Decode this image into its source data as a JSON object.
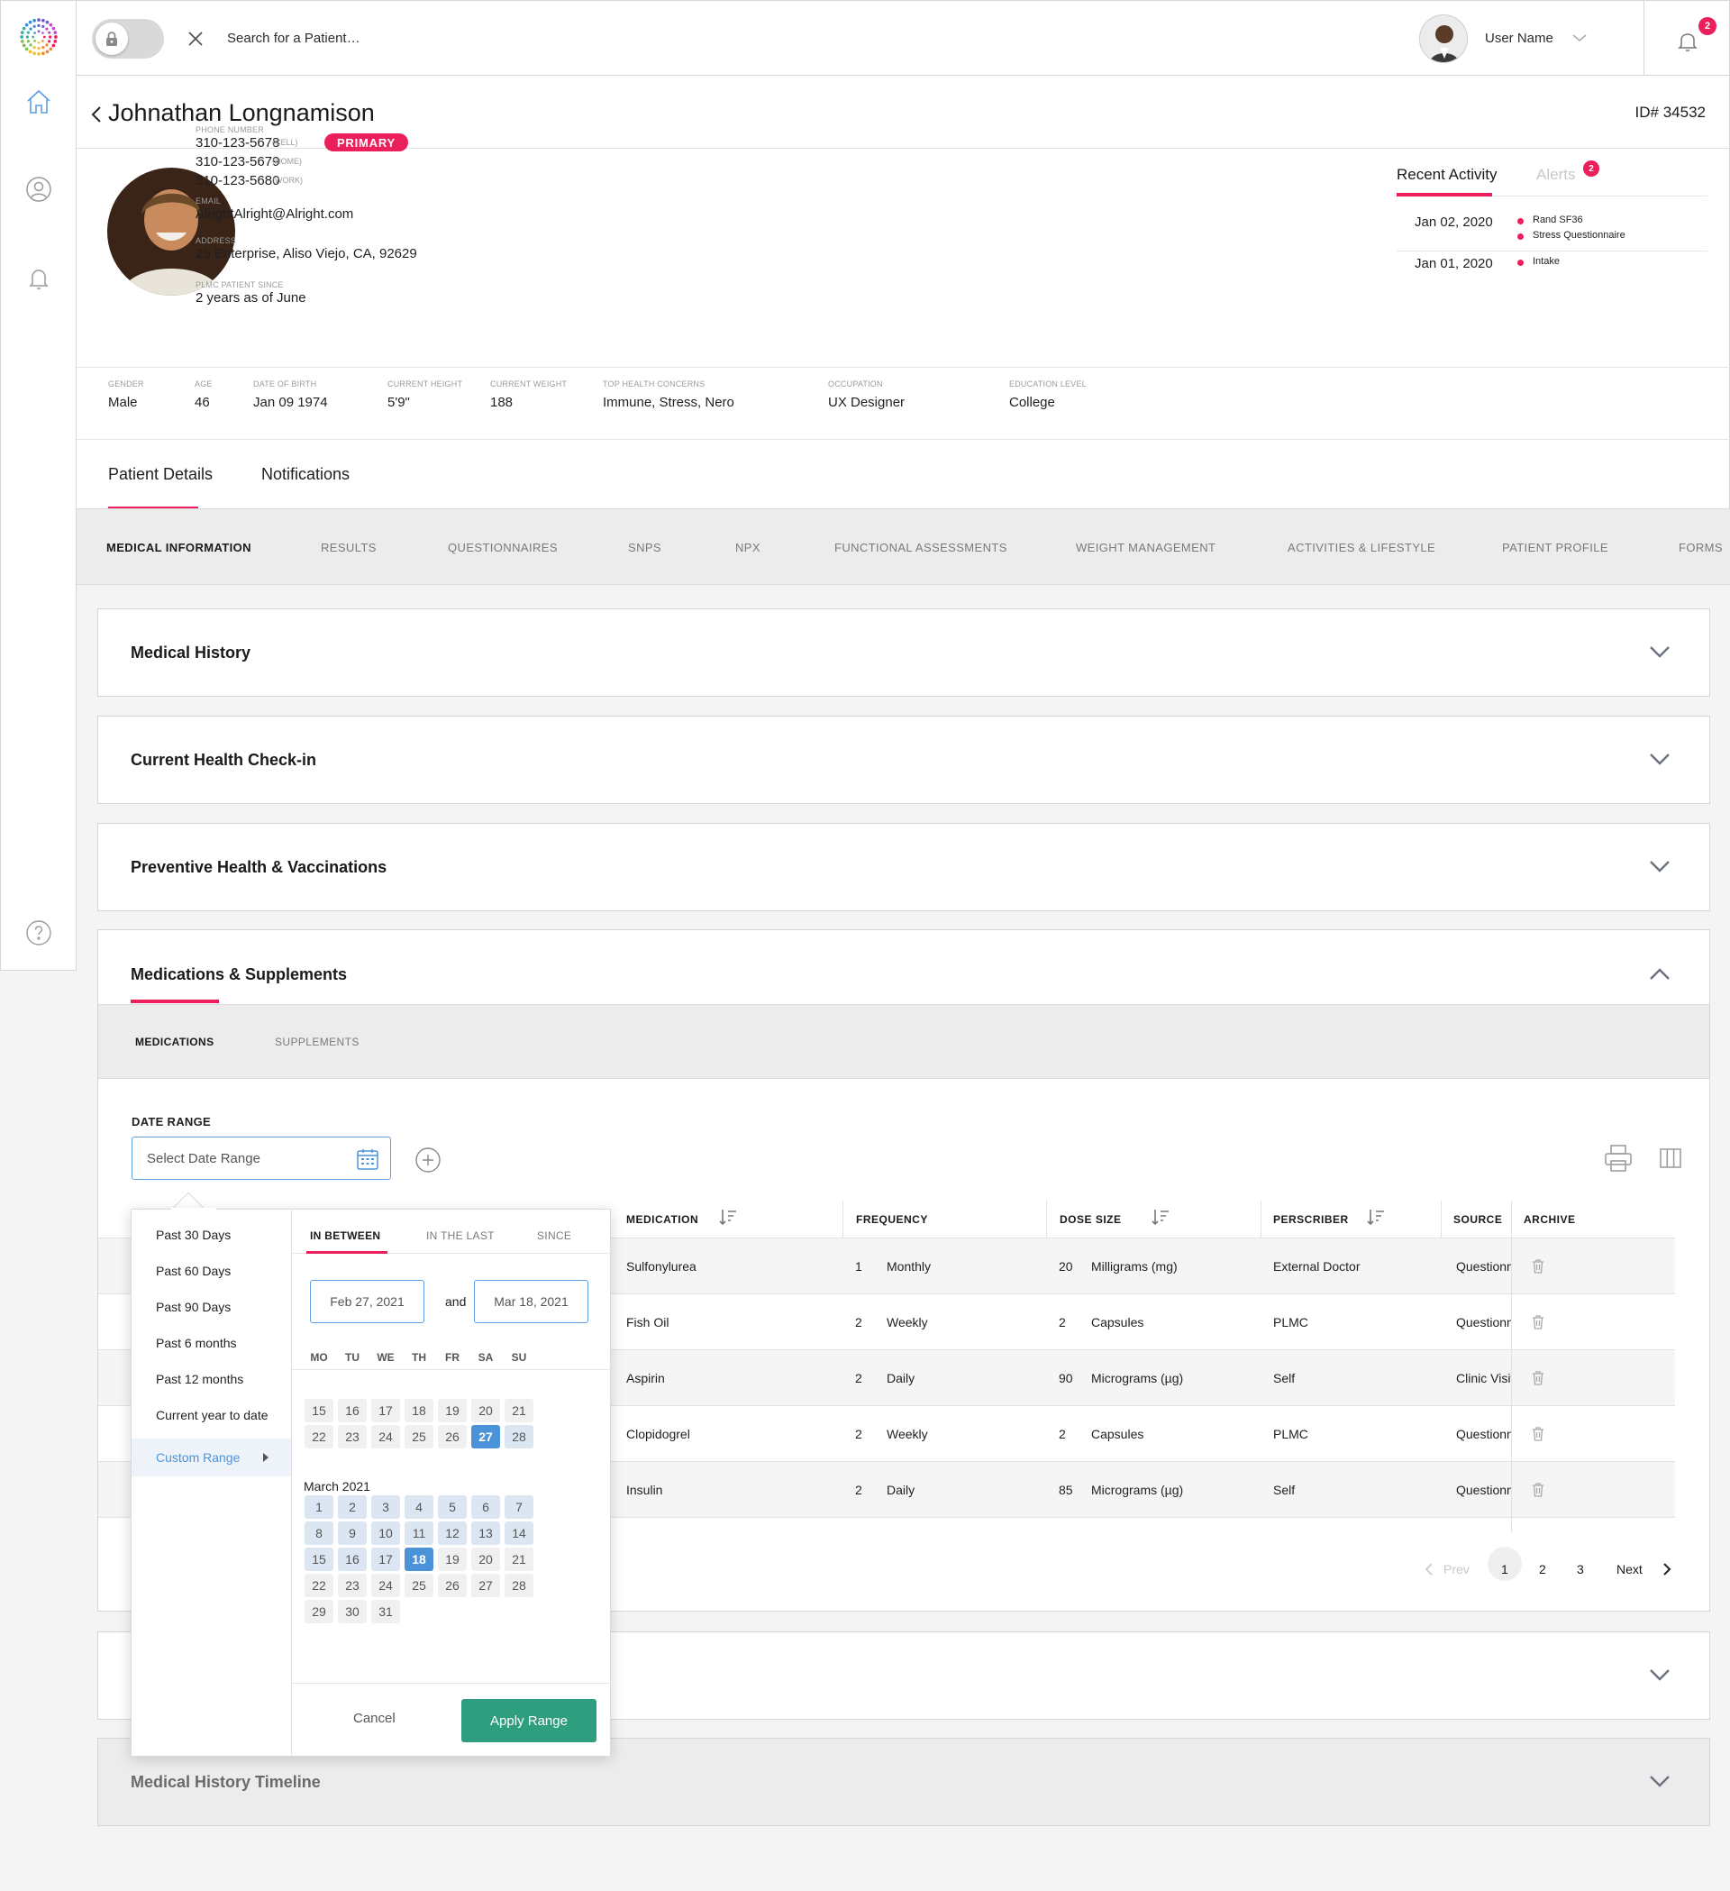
{
  "topbar": {
    "search_placeholder": "Search for a Patient…",
    "user_name": "User Name",
    "notification_count": "2"
  },
  "patient": {
    "name": "Johnathan Longnamison",
    "id": "ID# 34532",
    "phone_label": "PHONE NUMBER",
    "phones": [
      {
        "number": "310-123-5678",
        "type": "(CELL)"
      },
      {
        "number": "310-123-5679",
        "type": "(HOME)"
      },
      {
        "number": "310-123-5680",
        "type": "(WORK)"
      }
    ],
    "primary_label": "PRIMARY",
    "email_label": "EMAIL",
    "email": "AlrightAlright@Alright.com",
    "address_label": "ADDRESS",
    "address": "25 Enterprise, Aliso Viejo, CA, 92629",
    "since_label": "PLMC PATIENT SINCE",
    "since": "2 years as of June"
  },
  "activity": {
    "tabs": [
      "Recent Activity",
      "Alerts"
    ],
    "alerts_count": "2",
    "entries": [
      {
        "date": "Jan 02, 2020",
        "items": [
          "Rand SF36",
          "Stress Questionnaire"
        ]
      },
      {
        "date": "Jan 01, 2020",
        "items": [
          "Intake"
        ]
      }
    ]
  },
  "stats": [
    {
      "label": "GENDER",
      "value": "Male"
    },
    {
      "label": "AGE",
      "value": "46"
    },
    {
      "label": "DATE OF BIRTH",
      "value": "Jan 09 1974"
    },
    {
      "label": "CURRENT HEIGHT",
      "value": "5'9\""
    },
    {
      "label": "CURRENT WEIGHT",
      "value": "188"
    },
    {
      "label": "TOP HEALTH CONCERNS",
      "value": "Immune, Stress, Nero"
    },
    {
      "label": "OCCUPATION",
      "value": "UX Designer"
    },
    {
      "label": "EDUCATION LEVEL",
      "value": "College"
    }
  ],
  "page_tabs": [
    "Patient Details",
    "Notifications"
  ],
  "subnav": [
    "MEDICAL INFORMATION",
    "RESULTS",
    "QUESTIONNAIRES",
    "SNPS",
    "NPX",
    "FUNCTIONAL ASSESSMENTS",
    "WEIGHT MANAGEMENT",
    "ACTIVITIES & LIFESTYLE",
    "PATIENT PROFILE",
    "FORMS"
  ],
  "sections": {
    "medical_history": "Medical History",
    "checkin": "Current Health Check-in",
    "preventive": "Preventive Health & Vaccinations",
    "meds": "Medications & Supplements",
    "timeline": "Medical History Timeline"
  },
  "meds": {
    "tabs": [
      "MEDICATIONS",
      "SUPPLEMENTS"
    ],
    "date_range_label": "DATE RANGE",
    "date_range_placeholder": "Select Date Range",
    "columns": [
      "MEDICATION",
      "FREQUENCY",
      "DOSE SIZE",
      "PERSCRIBER",
      "SOURCE",
      "ARCHIVE"
    ],
    "rows": [
      {
        "name": "Sulfonylurea",
        "freq_n": "1",
        "freq": "Monthly",
        "dose_n": "20",
        "dose": "Milligrams (mg)",
        "prescriber": "External Doctor",
        "source": "Questionnaire"
      },
      {
        "name": "Fish Oil",
        "freq_n": "2",
        "freq": "Weekly",
        "dose_n": "2",
        "dose": "Capsules",
        "prescriber": "PLMC",
        "source": "Questionnaire"
      },
      {
        "name": "Aspirin",
        "freq_n": "2",
        "freq": "Daily",
        "dose_n": "90",
        "dose": "Micrograms (µg)",
        "prescriber": "Self",
        "source": "Clinic Visit"
      },
      {
        "name": "Clopidogrel",
        "freq_n": "2",
        "freq": "Weekly",
        "dose_n": "2",
        "dose": "Capsules",
        "prescriber": "PLMC",
        "source": "Questionnaire"
      },
      {
        "name": "Insulin",
        "freq_n": "2",
        "freq": "Daily",
        "dose_n": "85",
        "dose": "Micrograms (µg)",
        "prescriber": "Self",
        "source": "Questionnaire"
      }
    ],
    "pager": {
      "prev": "Prev",
      "pages": [
        "1",
        "2",
        "3"
      ],
      "next": "Next"
    }
  },
  "picker": {
    "presets": [
      "Past 30 Days",
      "Past 60 Days",
      "Past 90 Days",
      "Past 6 months",
      "Past 12 months",
      "Current year to date"
    ],
    "custom": "Custom Range",
    "tabs": [
      "IN BETWEEN",
      "IN THE LAST",
      "SINCE"
    ],
    "from": "Feb 27, 2021",
    "and": "and",
    "to": "Mar 18, 2021",
    "dow": [
      "MO",
      "TU",
      "WE",
      "TH",
      "FR",
      "SA",
      "SU"
    ],
    "feb_rows": [
      [
        "15",
        "16",
        "17",
        "18",
        "19",
        "20",
        "21"
      ],
      [
        "22",
        "23",
        "24",
        "25",
        "26",
        "27",
        "28"
      ]
    ],
    "month": "March 2021",
    "mar_rows": [
      [
        "1",
        "2",
        "3",
        "4",
        "5",
        "6",
        "7"
      ],
      [
        "8",
        "9",
        "10",
        "11",
        "12",
        "13",
        "14"
      ],
      [
        "15",
        "16",
        "17",
        "18",
        "19",
        "20",
        "21"
      ],
      [
        "22",
        "23",
        "24",
        "25",
        "26",
        "27",
        "28"
      ],
      [
        "29",
        "30",
        "31"
      ]
    ],
    "cancel": "Cancel",
    "apply": "Apply Range"
  }
}
